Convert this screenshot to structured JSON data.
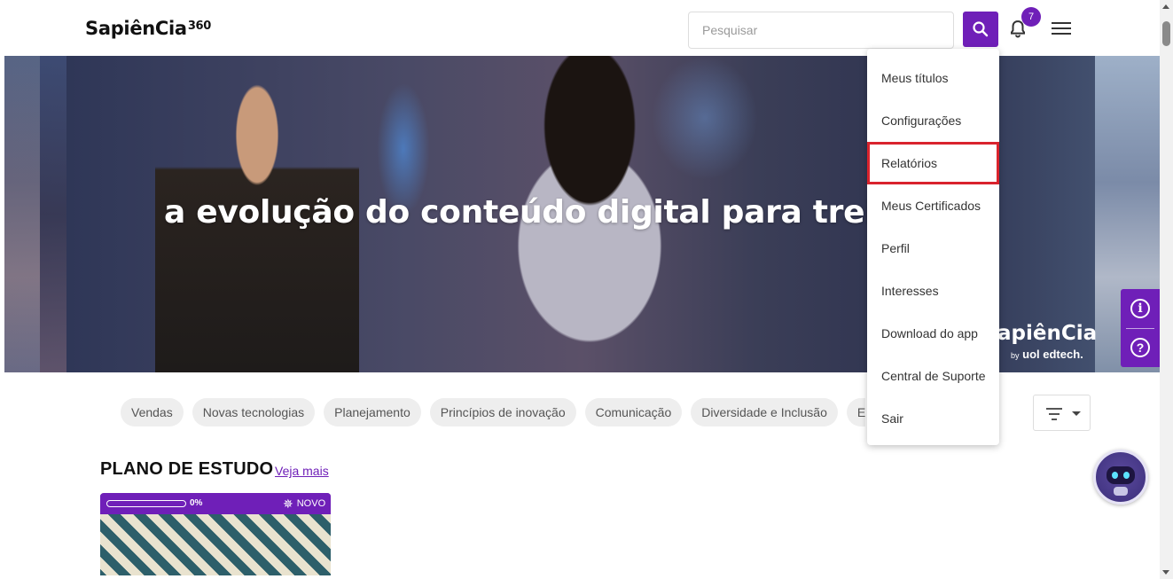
{
  "header": {
    "logo_text": "SapiênCia",
    "logo_suffix": "360",
    "search_placeholder": "Pesquisar",
    "search_icon": "search-icon",
    "notifications_icon": "bell-icon",
    "notification_count": "7",
    "menu_icon": "hamburger-icon"
  },
  "hero": {
    "headline": "a evolução do conteúdo digital para trein",
    "brand_text": "apiênCia",
    "brand_by": "by",
    "brand_company": "uol edtech."
  },
  "menu": {
    "items": [
      {
        "label": "Meus títulos"
      },
      {
        "label": "Configurações"
      },
      {
        "label": "Relatórios",
        "highlighted": true
      },
      {
        "label": "Meus Certificados"
      },
      {
        "label": "Perfil"
      },
      {
        "label": "Interesses"
      },
      {
        "label": "Download do app"
      },
      {
        "label": "Central de Suporte"
      },
      {
        "label": "Sair"
      }
    ]
  },
  "categories": {
    "chips": [
      "Vendas",
      "Novas tecnologias",
      "Planejamento",
      "Princípios de inovação",
      "Comunicação",
      "Diversidade e Inclusão",
      "Expe"
    ],
    "next_icon": "chevron-right-icon",
    "filter_icon": "filter-icon"
  },
  "side_tools": {
    "info_icon": "info-icon",
    "info_symbol": "i",
    "help_icon": "help-icon",
    "help_symbol": "?"
  },
  "study_plan": {
    "title": "PLANO DE ESTUDO",
    "see_more": "Veja mais",
    "card": {
      "progress_label": "0%",
      "progress_fraction": 0,
      "new_badge": "NOVO"
    }
  },
  "colors": {
    "accent": "#6f1fb8",
    "highlight_border": "#d9232d",
    "chip_background": "#eeeeee"
  },
  "chatbot": {
    "icon": "robot-icon"
  }
}
